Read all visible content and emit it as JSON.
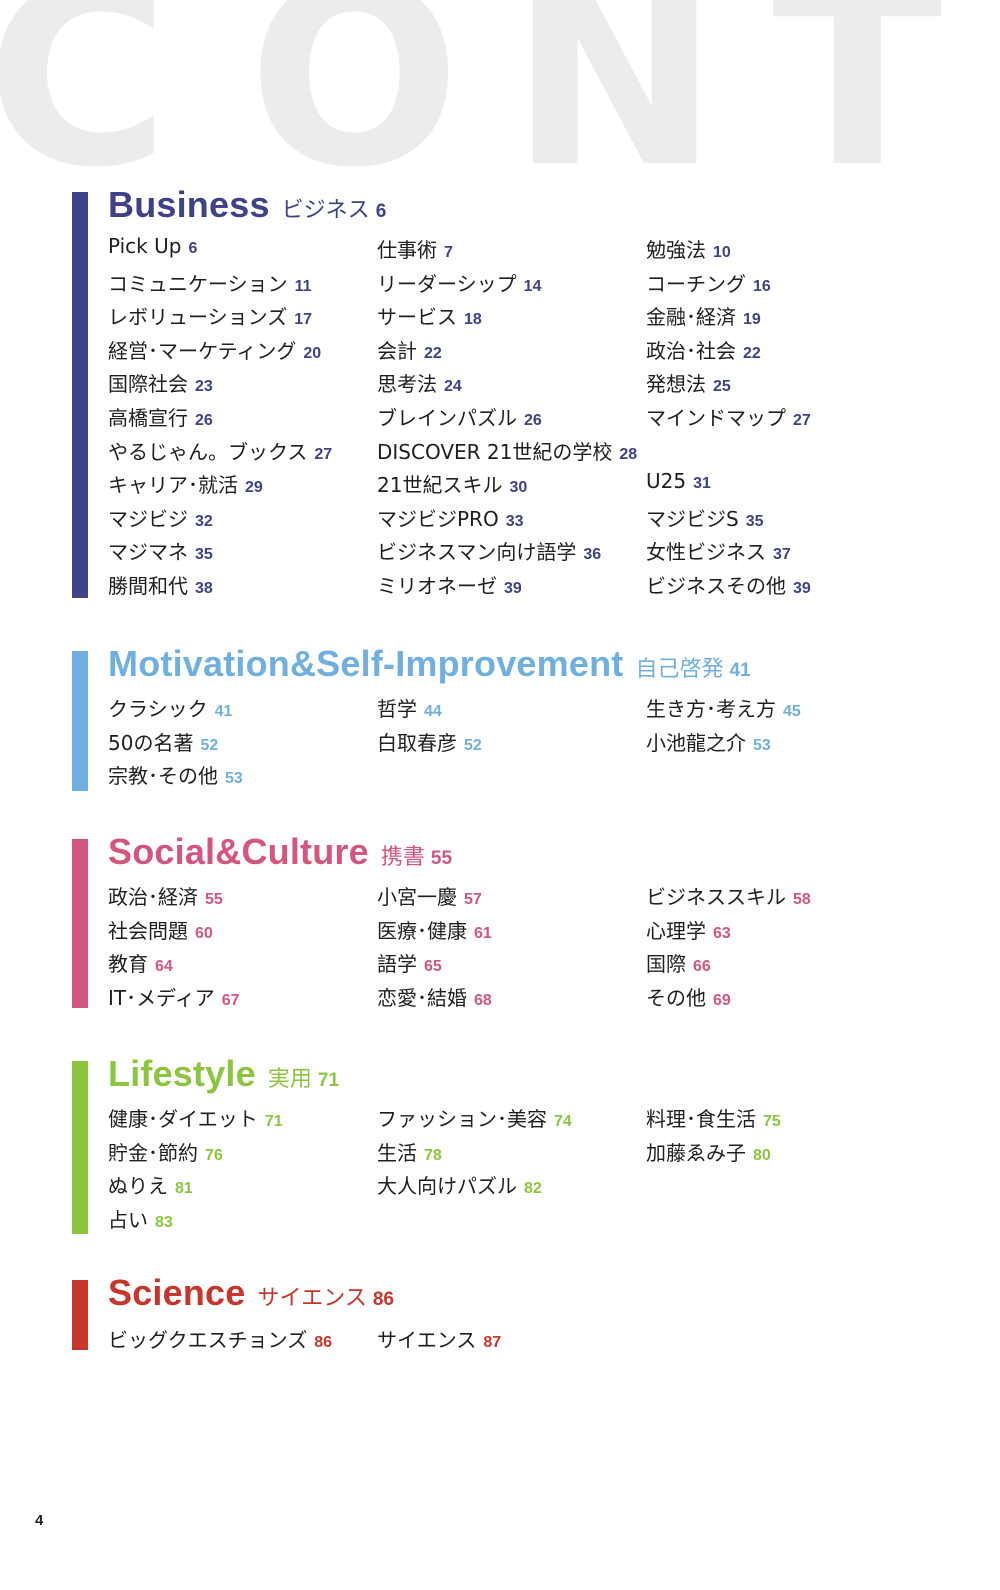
{
  "header": {
    "letters": [
      "C",
      "O",
      "N",
      "T"
    ]
  },
  "sections": [
    {
      "title": "Business",
      "subtitle": "ビジネス",
      "page": "6",
      "color": "#3e4287",
      "items": [
        {
          "label": "Pick Up",
          "page": "6"
        },
        {
          "label": "仕事術",
          "page": "7"
        },
        {
          "label": "勉強法",
          "page": "10"
        },
        {
          "label": "コミュニケーション",
          "page": "11"
        },
        {
          "label": "リーダーシップ",
          "page": "14"
        },
        {
          "label": "コーチング",
          "page": "16"
        },
        {
          "label": "レボリューションズ",
          "page": "17"
        },
        {
          "label": "サービス",
          "page": "18"
        },
        {
          "label": "金融･経済",
          "page": "19"
        },
        {
          "label": "経営･マーケティング",
          "page": "20"
        },
        {
          "label": "会計",
          "page": "22"
        },
        {
          "label": "政治･社会",
          "page": "22"
        },
        {
          "label": "国際社会",
          "page": "23"
        },
        {
          "label": "思考法",
          "page": "24"
        },
        {
          "label": "発想法",
          "page": "25"
        },
        {
          "label": "高橋宣行",
          "page": "26"
        },
        {
          "label": "ブレインパズル",
          "page": "26"
        },
        {
          "label": "マインドマップ",
          "page": "27"
        },
        {
          "label": "やるじゃん。ブックス",
          "page": "27"
        },
        {
          "label": "DISCOVER 21世紀の学校",
          "page": "28"
        },
        {
          "label": "",
          "page": ""
        },
        {
          "label": "キャリア･就活",
          "page": "29"
        },
        {
          "label": "21世紀スキル",
          "page": "30"
        },
        {
          "label": "U25",
          "page": "31"
        },
        {
          "label": "マジビジ",
          "page": "32"
        },
        {
          "label": "マジビジPRO",
          "page": "33"
        },
        {
          "label": "マジビジS",
          "page": "35"
        },
        {
          "label": "マジマネ",
          "page": "35"
        },
        {
          "label": "ビジネスマン向け語学",
          "page": "36"
        },
        {
          "label": "女性ビジネス",
          "page": "37"
        },
        {
          "label": "勝間和代",
          "page": "38"
        },
        {
          "label": "ミリオネーゼ",
          "page": "39"
        },
        {
          "label": "ビジネスその他",
          "page": "39"
        }
      ]
    },
    {
      "title": "Motivation&Self-Improvement",
      "subtitle": "自己啓発",
      "page": "41",
      "color": "#6fb0e0",
      "items": [
        {
          "label": "クラシック",
          "page": "41"
        },
        {
          "label": "哲学",
          "page": "44"
        },
        {
          "label": "生き方･考え方",
          "page": "45"
        },
        {
          "label": "50の名著",
          "page": "52"
        },
        {
          "label": "白取春彦",
          "page": "52"
        },
        {
          "label": "小池龍之介",
          "page": "53"
        },
        {
          "label": "宗教･その他",
          "page": "53"
        }
      ]
    },
    {
      "title": "Social&Culture",
      "subtitle": "携書",
      "page": "55",
      "color": "#d4567d",
      "items": [
        {
          "label": "政治･経済",
          "page": "55"
        },
        {
          "label": "小宮一慶",
          "page": "57"
        },
        {
          "label": "ビジネススキル",
          "page": "58"
        },
        {
          "label": "社会問題",
          "page": "60"
        },
        {
          "label": "医療･健康",
          "page": "61"
        },
        {
          "label": "心理学",
          "page": "63"
        },
        {
          "label": "教育",
          "page": "64"
        },
        {
          "label": "語学",
          "page": "65"
        },
        {
          "label": "国際",
          "page": "66"
        },
        {
          "label": "IT･メディア",
          "page": "67"
        },
        {
          "label": "恋愛･結婚",
          "page": "68"
        },
        {
          "label": "その他",
          "page": "69"
        }
      ]
    },
    {
      "title": "Lifestyle",
      "subtitle": "実用",
      "page": "71",
      "color": "#8cc63e",
      "items": [
        {
          "label": "健康･ダイエット",
          "page": "71"
        },
        {
          "label": "ファッション･美容",
          "page": "74"
        },
        {
          "label": "料理･食生活",
          "page": "75"
        },
        {
          "label": "貯金･節約",
          "page": "76"
        },
        {
          "label": "生活",
          "page": "78"
        },
        {
          "label": "加藤ゑみ子",
          "page": "80"
        },
        {
          "label": "ぬりえ",
          "page": "81"
        },
        {
          "label": "大人向けパズル",
          "page": "82"
        },
        {
          "label": "",
          "page": ""
        },
        {
          "label": "占い",
          "page": "83"
        }
      ]
    },
    {
      "title": "Science",
      "subtitle": "サイエンス",
      "page": "86",
      "color": "#c8352c",
      "items": [
        {
          "label": "ビッグクエスチョンズ",
          "page": "86"
        },
        {
          "label": "サイエンス",
          "page": "87"
        }
      ]
    }
  ],
  "footer": {
    "page_number": "4"
  }
}
